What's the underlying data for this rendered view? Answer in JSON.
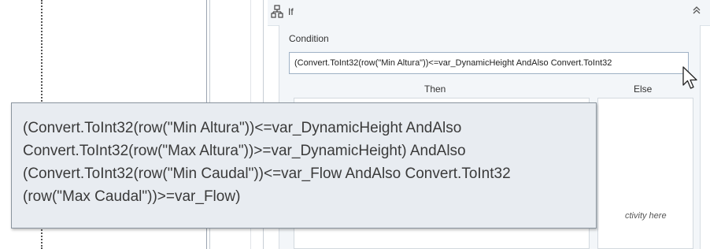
{
  "activity": {
    "title": "If",
    "icon": "if-branch-icon",
    "collapse_icon": "double-chevron-up-icon",
    "collapse_glyph": "»"
  },
  "condition": {
    "label": "Condition",
    "value": "(Convert.ToInt32(row(\"Min Altura\"))<=var_DynamicHeight AndAlso Convert.ToInt32"
  },
  "branches": {
    "then_label": "Then",
    "else_label": "Else",
    "drop_hint": "ctivity here"
  },
  "tooltip": {
    "lines": [
      "(Convert.ToInt32(row(\"Min Altura\"))<=var_DynamicHeight AndAlso",
      "Convert.ToInt32(row(\"Max Altura\"))>=var_DynamicHeight) AndAlso",
      "(Convert.ToInt32(row(\"Min Caudal\"))<=var_Flow AndAlso Convert.ToInt32",
      "(row(\"Max Caudal\"))>=var_Flow)"
    ]
  },
  "colors": {
    "panel_background": "#f3f6f9",
    "input_border": "#9fb1c5",
    "tooltip_background": "#e8ecf1",
    "tooltip_border": "#8a949e"
  }
}
